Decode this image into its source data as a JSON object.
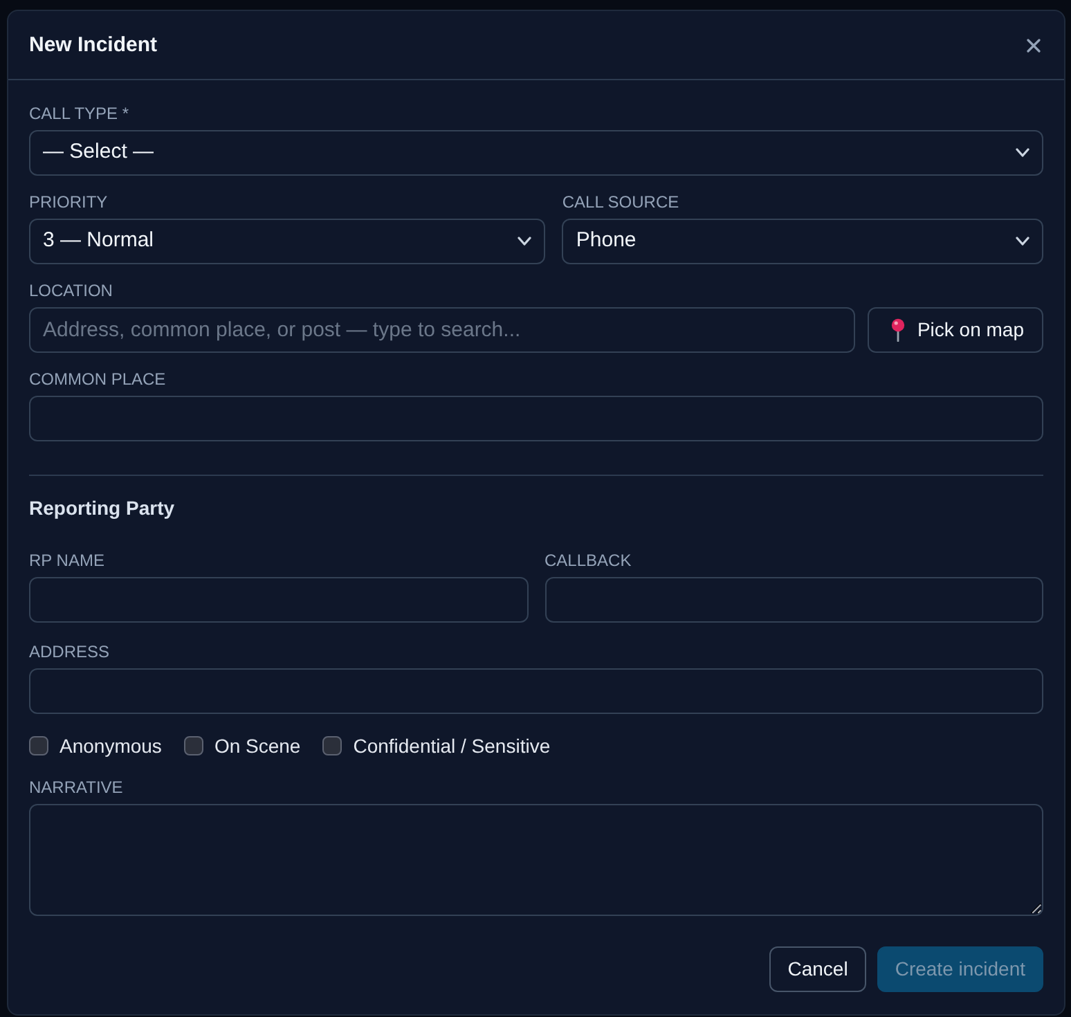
{
  "dialog": {
    "title": "New Incident"
  },
  "call_type": {
    "label": "CALL TYPE *",
    "value": "— Select —"
  },
  "priority": {
    "label": "PRIORITY",
    "value": "3 — Normal"
  },
  "call_source": {
    "label": "CALL SOURCE",
    "value": "Phone"
  },
  "location": {
    "label": "LOCATION",
    "placeholder": "Address, common place, or post — type to search...",
    "map_button": "Pick on map"
  },
  "common_place": {
    "label": "COMMON PLACE"
  },
  "reporting_party": {
    "heading": "Reporting Party",
    "rp_name": {
      "label": "RP NAME"
    },
    "callback": {
      "label": "CALLBACK"
    },
    "address": {
      "label": "ADDRESS"
    },
    "flags": [
      {
        "label": "Anonymous",
        "checked": false
      },
      {
        "label": "On Scene",
        "checked": false
      },
      {
        "label": "Confidential / Sensitive",
        "checked": false
      }
    ]
  },
  "narrative": {
    "label": "NARRATIVE"
  },
  "buttons": [
    {
      "label": "Cancel",
      "kind": "secondary",
      "disabled": false
    },
    {
      "label": "Create incident",
      "kind": "primary",
      "disabled": true
    }
  ]
}
